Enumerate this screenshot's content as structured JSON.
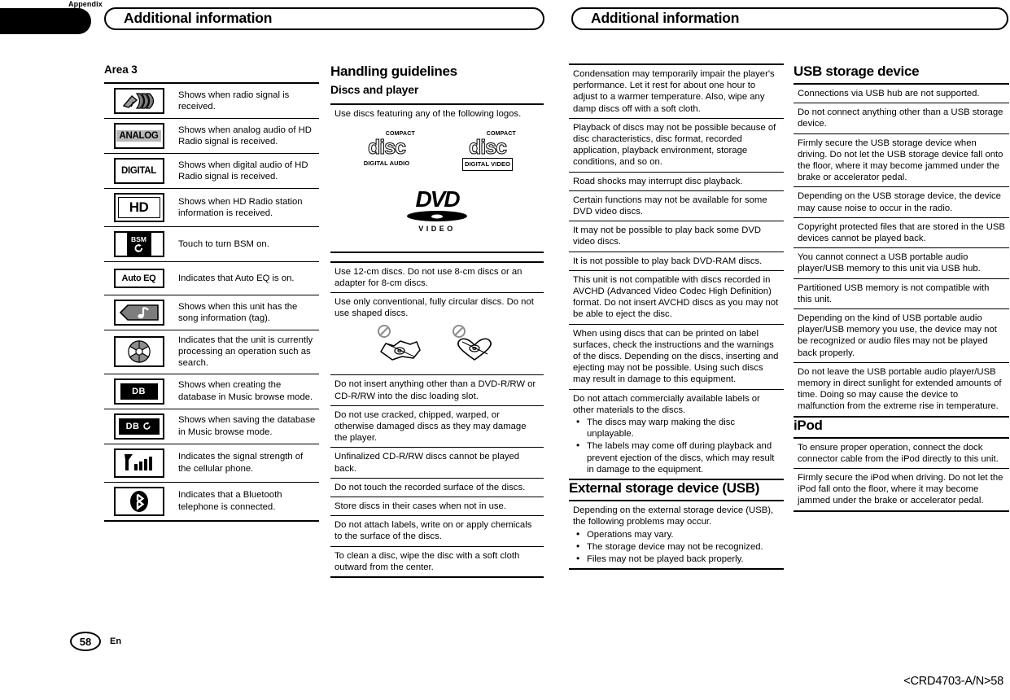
{
  "page": {
    "appendix_label": "Appendix",
    "banner_left_title": "Additional information",
    "banner_right_title": "Additional information",
    "page_number": "58",
    "language_code": "En",
    "document_code": "<CRD4703-A/N>58"
  },
  "column1": {
    "heading": "Area 3",
    "icon_rows": [
      {
        "icon": "radio-signal-icon",
        "label": "",
        "desc": "Shows when radio signal is received."
      },
      {
        "icon": "analog-badge-icon",
        "label": "ANALOG",
        "desc": "Shows when analog audio of HD Radio signal is received."
      },
      {
        "icon": "digital-badge-icon",
        "label": "DIGITAL",
        "desc": "Shows when digital audio of HD Radio signal is received."
      },
      {
        "icon": "hd-badge-icon",
        "label": "HD",
        "desc": "Shows when HD Radio station information is received."
      },
      {
        "icon": "bsm-badge-icon",
        "label": "BSM",
        "desc": "Touch to turn BSM on."
      },
      {
        "icon": "auto-eq-badge-icon",
        "label": "Auto EQ",
        "desc": "Indicates that Auto EQ is on."
      },
      {
        "icon": "song-tag-icon",
        "label": "",
        "desc": "Shows when this unit has the song information (tag)."
      },
      {
        "icon": "processing-spinner-icon",
        "label": "",
        "desc": "Indicates that the unit is currently processing an operation such as search."
      },
      {
        "icon": "database-creating-icon",
        "label": "DB",
        "desc": "Shows when creating the database in Music browse mode."
      },
      {
        "icon": "database-saving-icon",
        "label": "DB",
        "desc": "Shows when saving the database in Music browse mode."
      },
      {
        "icon": "cellular-signal-icon",
        "label": "",
        "desc": "Indicates the signal strength of the cellular phone."
      },
      {
        "icon": "bluetooth-icon",
        "label": "",
        "desc": "Indicates that a Bluetooth telephone is connected."
      }
    ]
  },
  "column2": {
    "heading": "Handling guidelines",
    "subheading": "Discs and player",
    "logo_intro": "Use discs featuring any of the following logos.",
    "logos": {
      "cd_audio": {
        "top": "COMPACT",
        "main": "disc",
        "bottom": "DIGITAL AUDIO"
      },
      "cd_video": {
        "top": "COMPACT",
        "main": "disc",
        "bottom": "DIGITAL VIDEO"
      },
      "dvd": {
        "main": "DVD",
        "bottom": "VIDEO"
      }
    },
    "rules": [
      {
        "text": "Use 12-cm discs. Do not use 8-cm discs or an adapter for 8-cm discs."
      },
      {
        "text": "Use only conventional, fully circular discs. Do not use shaped discs.",
        "has_shape_illustration": true
      },
      {
        "text": "Do not insert anything other than a DVD-R/RW or CD-R/RW into the disc loading slot."
      },
      {
        "text": "Do not use cracked, chipped, warped, or otherwise damaged discs as they may damage the player."
      },
      {
        "text": "Unfinalized CD-R/RW discs cannot be played back."
      },
      {
        "text": "Do not touch the recorded surface of the discs."
      },
      {
        "text": "Store discs in their cases when not in use."
      },
      {
        "text": "Do not attach labels, write on or apply chemicals to the surface of the discs."
      },
      {
        "text": "To clean a disc, wipe the disc with a soft cloth outward from the center."
      }
    ]
  },
  "column3": {
    "rules": [
      {
        "text": "Condensation may temporarily impair the player's performance. Let it rest for about one hour to adjust to a warmer temperature. Also, wipe any damp discs off with a soft cloth."
      },
      {
        "text": "Playback of discs may not be possible because of disc characteristics, disc format, recorded application, playback environment, storage conditions, and so on."
      },
      {
        "text": "Road shocks may interrupt disc playback."
      },
      {
        "text": "Certain functions may not be available for some DVD video discs."
      },
      {
        "text": "It may not be possible to play back some DVD video discs."
      },
      {
        "text": "It is not possible to play back DVD-RAM discs."
      },
      {
        "text": "This unit is not compatible with discs recorded in AVCHD (Advanced Video Codec High Definition) format. Do not insert AVCHD discs as you may not be able to eject the disc."
      },
      {
        "text": "When using discs that can be printed on label surfaces, check the instructions and the warnings of the discs. Depending on the discs, inserting and ejecting may not be possible. Using such discs may result in damage to this equipment."
      },
      {
        "text": "Do not attach commercially available labels or other materials to the discs.",
        "bullets": [
          "The discs may warp making the disc unplayable.",
          "The labels may come off during playback and prevent ejection of the discs, which may result in damage to the equipment."
        ]
      }
    ],
    "usb_heading": "External storage device (USB)",
    "usb_rules": [
      {
        "text": "Depending on the external storage device (USB), the following problems may occur.",
        "bullets": [
          "Operations may vary.",
          "The storage device may not be recognized.",
          "Files may not be played back properly."
        ]
      }
    ]
  },
  "column4": {
    "usb_heading": "USB storage device",
    "usb_rules": [
      {
        "text": "Connections via USB hub are not supported."
      },
      {
        "text": "Do not connect anything other than a USB storage device."
      },
      {
        "text": "Firmly secure the USB storage device when driving. Do not let the USB storage device fall onto the floor, where it may become jammed under the brake or accelerator pedal."
      },
      {
        "text": "Depending on the USB storage device, the device may cause noise to occur in the radio."
      },
      {
        "text": "Copyright protected files that are stored in the USB devices cannot be played back."
      },
      {
        "text": "You cannot connect a USB portable audio player/USB memory to this unit via USB hub."
      },
      {
        "text": "Partitioned USB memory is not compatible with this unit."
      },
      {
        "text": "Depending on the kind of USB portable audio player/USB memory you use, the device may not be recognized or audio files may not be played back properly."
      },
      {
        "text": "Do not leave the USB portable audio player/USB memory in direct sunlight for extended amounts of time. Doing so may cause the device to malfunction from the extreme rise in temperature."
      }
    ],
    "ipod_heading": "iPod",
    "ipod_rules": [
      {
        "text": "To ensure proper operation, connect the dock connector cable from the iPod directly to this unit."
      },
      {
        "text": "Firmly secure the iPod when driving. Do not let the iPod fall onto the floor, where it may become jammed under the brake or accelerator pedal."
      }
    ]
  }
}
